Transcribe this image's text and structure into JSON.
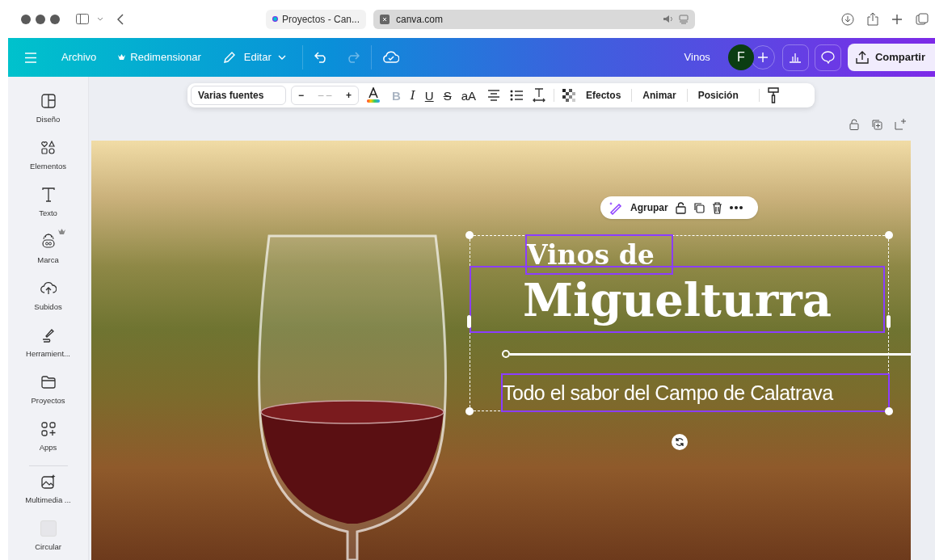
{
  "browser": {
    "tabs": [
      {
        "label": "Proyectos - Can...",
        "selected": false
      },
      {
        "label": "canva.com",
        "selected": true
      }
    ]
  },
  "top_bar": {
    "menu": [
      {
        "label": "Archivo",
        "premium": false,
        "kind": "plain"
      },
      {
        "label": "Redimensionar",
        "premium": true,
        "kind": "plain"
      },
      {
        "label": "Editar",
        "premium": false,
        "kind": "dropdown"
      }
    ],
    "design_title": "Vinos",
    "avatar": "F",
    "share": "Compartir"
  },
  "text_toolbar": {
    "font": "Varias fuentes",
    "size_decrease": "−",
    "size": "– –",
    "size_increase": "+",
    "format_buttons": [
      {
        "label": "B",
        "kind": "bold",
        "disabled": true
      },
      {
        "label": "I",
        "kind": "italic",
        "disabled": false
      },
      {
        "label": "U",
        "kind": "underline",
        "disabled": false
      },
      {
        "label": "S",
        "kind": "strike",
        "disabled": false
      },
      {
        "label": "aA",
        "kind": "case",
        "disabled": false
      }
    ],
    "buttons": [
      "Efectos",
      "Animar",
      "Posición"
    ]
  },
  "sidebar": {
    "items": [
      {
        "label": "Diseño",
        "kind": "icon",
        "premium": false
      },
      {
        "label": "Elementos",
        "kind": "icon",
        "premium": false
      },
      {
        "label": "Texto",
        "kind": "icon",
        "premium": false
      },
      {
        "label": "Marca",
        "kind": "icon",
        "premium": true
      },
      {
        "label": "Subidos",
        "kind": "icon",
        "premium": false
      },
      {
        "label": "Herramient...",
        "kind": "icon",
        "premium": false
      },
      {
        "label": "Proyectos",
        "kind": "icon",
        "premium": false
      },
      {
        "label": "Apps",
        "kind": "icon",
        "premium": false
      },
      {
        "label": "Multimedia ...",
        "kind": "icon",
        "premium": false
      },
      {
        "label": "Circular",
        "kind": "thumbnail",
        "premium": false
      }
    ]
  },
  "canvas": {
    "floating_toolbar": {
      "label": "Agrupar"
    },
    "heading_small": "Vinos de",
    "heading_large": "Miguelturra",
    "subtitle": "Todo el sabor del Campo de Calatrava"
  }
}
